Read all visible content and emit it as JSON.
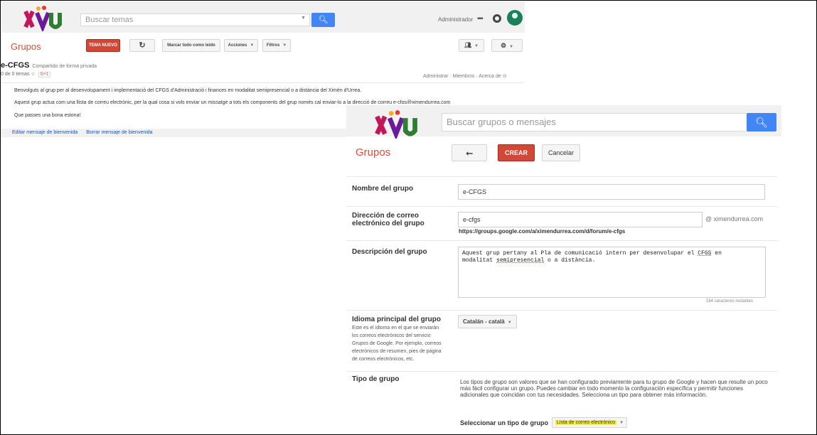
{
  "background": {
    "search_placeholder": "Buscar temas",
    "user_label": "Administrador",
    "brand": "Grupos",
    "toolbar": {
      "new_topic": "TEMA NUEVO",
      "mark_read": "Marcar todo como leído",
      "actions": "Acciones",
      "filters": "Filtros"
    },
    "group": {
      "title": "e-CFGS",
      "subtitle": "Compartido de forma privada",
      "count": "0 de 0 temas",
      "gplus": "G+1"
    },
    "group_links": {
      "admin": "Administrar",
      "members": "Miembros",
      "about": "Acerca de"
    },
    "welcome": {
      "line1": "Benvolguts al grup per al desenvolupament i implementació del CFGS d'Administració i finances en modalitat semipresencial o a distància del Ximén d'Urrea.",
      "line2": "Aquest grup actua com una llista de correu electrònic, per la qual cosa si vols enviar un missatge a tots els components del grup només cal enviar-lo a la direcció de correu e-cfgs@ximendurrea.com",
      "line3": "Que passes una bona estona!",
      "edit_link": "Editar mensaje de bienvenida",
      "delete_link": "Borrar mensaje de bienvenida"
    }
  },
  "overlay": {
    "search_placeholder": "Buscar grupos o mensajes",
    "brand": "Grupos",
    "buttons": {
      "back_icon": "arrow-left",
      "create": "CREAR",
      "cancel": "Cancelar"
    },
    "form": {
      "name_label": "Nombre del grupo",
      "name_value": "e-CFGS",
      "email_label": "Dirección de correo electrónico del grupo",
      "email_value": "e-cfgs",
      "email_domain": "@ ximendurrea.com",
      "email_url": "https://groups.google.com/a/ximendurrea.com/d/forum/e-cfgs",
      "desc_label": "Descripción del grupo",
      "desc_text_1": "Aquest grup pertany al Pla de comunicació intern per desenvolupar el ",
      "desc_text_cfgs": "CFGS",
      "desc_text_2": " en\nmodalitat ",
      "desc_text_semi": "semipresencial",
      "desc_text_3": " o a distància.",
      "desc_remaining": "184 caracteres restantes",
      "lang_label": "Idioma principal del grupo",
      "lang_hint": "Este es el idioma en el que se enviarán los correos electrónicos del servicio Grupos de Google. Por ejemplo, correos electrónicos de resumen, pies de página de correos electrónicos, etc.",
      "lang_value": "Catalán - català",
      "type_label": "Tipo de grupo",
      "type_desc": "Los tipos de grupo son valores que se han configurado previamente para tu grupo de Google y hacen que resulte un poco más fácil configurar un grupo. Puedes cambiar en todo momento la configuración específica y permitir funciones adicionales que coincidan con tus necesidades. Selecciona un tipo para obtener más información.",
      "type_select_label": "Seleccionar un tipo de grupo",
      "type_select_value": "Lista de correo electrónico"
    }
  },
  "colors": {
    "brand_red": "#dd4b39",
    "action_red": "#d14836",
    "search_blue": "#4285f4",
    "link_blue": "#1155cc",
    "highlight": "#f4f032"
  }
}
